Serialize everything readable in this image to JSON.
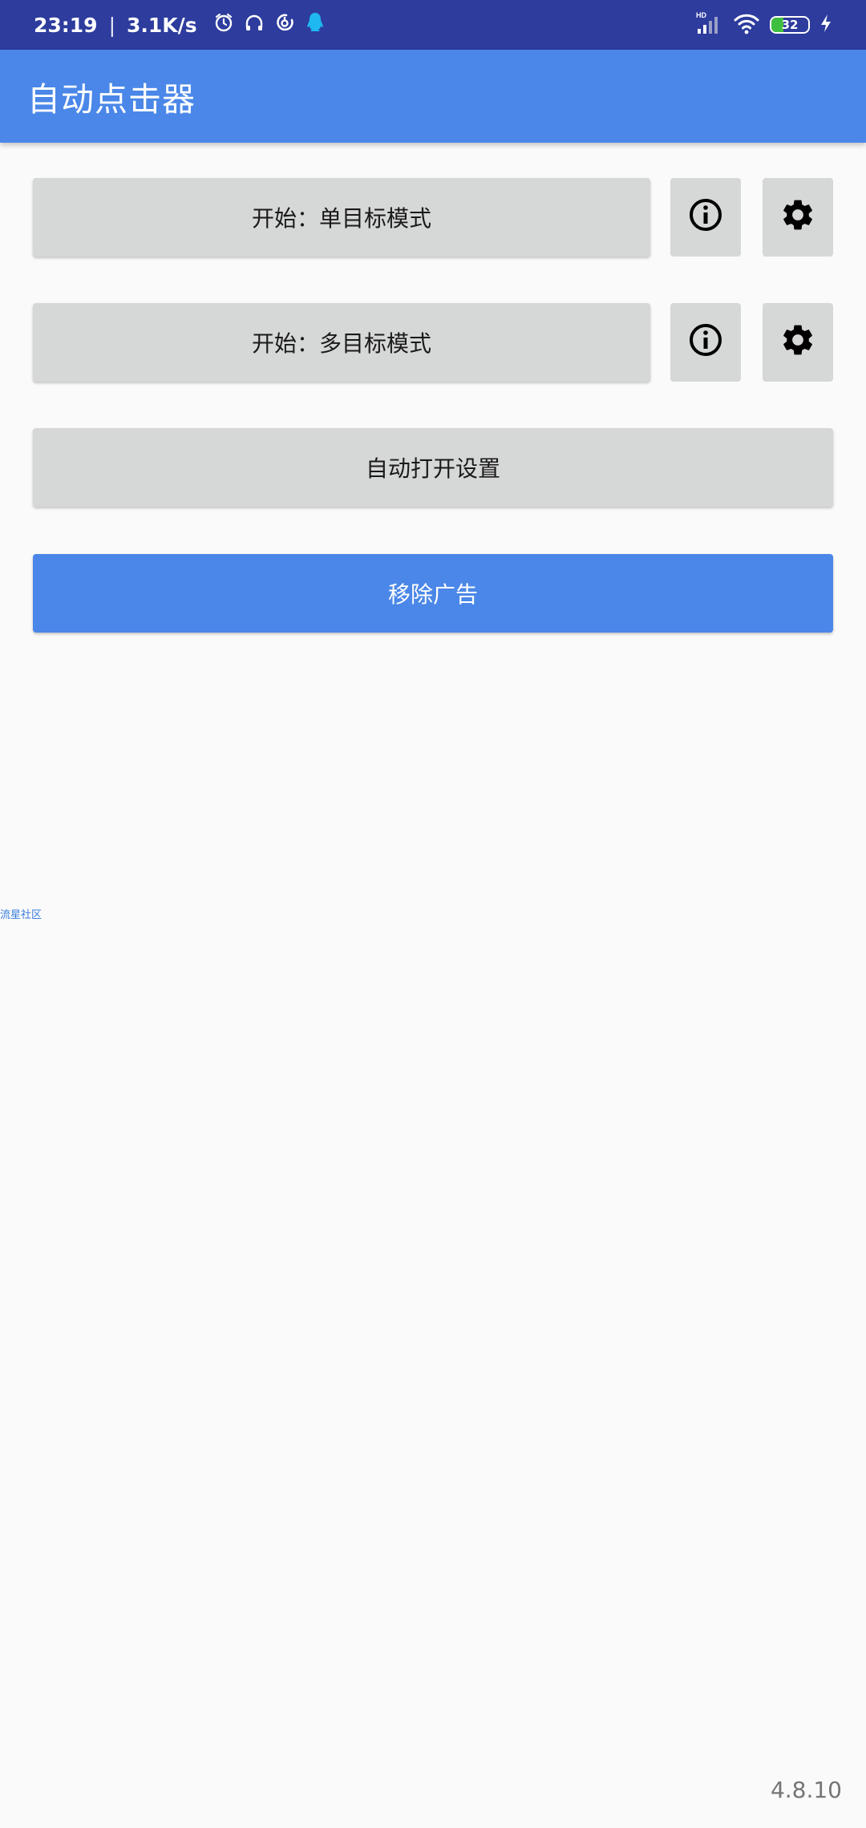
{
  "status_bar": {
    "time": "23:19",
    "separator": "|",
    "network_speed": "3.1K/s",
    "network_type": "HD",
    "battery_level": "32",
    "icons": [
      "alarm-icon",
      "headphones-icon",
      "netease-music-icon",
      "qq-icon",
      "signal-icon",
      "wifi-icon",
      "battery-icon",
      "charging-icon"
    ]
  },
  "app_bar": {
    "title": "自动点击器"
  },
  "main": {
    "single_target_button": "开始：单目标模式",
    "multi_target_button": "开始：多目标模式",
    "auto_open_settings_button": "自动打开设置",
    "remove_ads_button": "移除广告",
    "info_icon": "info-icon",
    "settings_icon": "gear-icon"
  },
  "ad_link": {
    "text": "流星社区"
  },
  "footer": {
    "version": "4.8.10"
  },
  "colors": {
    "status_bar": "#2d3c9d",
    "app_bar": "#4a87e8",
    "primary_button": "#4a87e8",
    "secondary_button": "#d6d7d7",
    "background": "#fafafa"
  }
}
